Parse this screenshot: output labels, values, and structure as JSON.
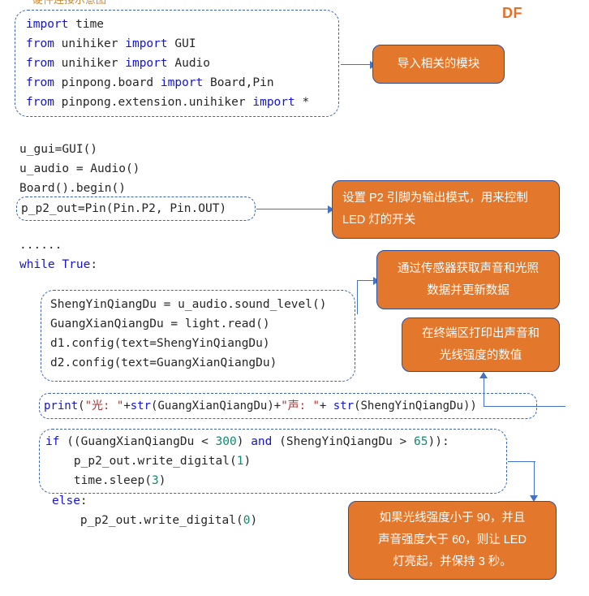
{
  "logo": {
    "text": "DF"
  },
  "top_clipped_heading": {
    "text": "硬件连接示意图"
  },
  "code_blocks": {
    "imports": {
      "lines": [
        "import time",
        "from unihiker import GUI",
        "from unihiker import Audio",
        "from pinpong.board import Board,Pin",
        "from pinpong.extension.unihiker import *"
      ]
    },
    "setup_plain": {
      "lines": [
        "u_gui=GUI()",
        "u_audio = Audio()",
        "Board().begin()"
      ]
    },
    "pin_setup": {
      "lines": [
        "p_p2_out=Pin(Pin.P2, Pin.OUT)"
      ]
    },
    "loop_plain": {
      "lines": [
        "......",
        "while True:"
      ]
    },
    "sensor_read": {
      "lines": [
        "ShengYinQiangDu = u_audio.sound_level()",
        "GuangXianQiangDu = light.read()",
        "d1.config(text=ShengYinQiangDu)",
        "d2.config(text=GuangXianQiangDu)"
      ]
    },
    "print_line": {
      "lines": [
        "print(\"光: \"+str(GuangXianQiangDu)+\"声: \"+ str(ShengYinQiangDu))"
      ]
    },
    "if_block": {
      "lines": [
        "if ((GuangXianQiangDu < 300) and (ShengYinQiangDu > 65)):",
        "    p_p2_out.write_digital(1)",
        "    time.sleep(3)"
      ]
    },
    "else_block": {
      "lines": [
        "else:",
        "    p_p2_out.write_digital(0)"
      ]
    }
  },
  "callouts": {
    "imports": {
      "lines": [
        "导入相关的模块"
      ],
      "align": "center"
    },
    "pin_setup": {
      "lines": [
        "设置 P2 引脚为输出模式，用来控制",
        "LED 灯的开关"
      ],
      "align": "left"
    },
    "sensor_read": {
      "lines": [
        "通过传感器获取声音和光照",
        "数据并更新数据"
      ],
      "align": "center"
    },
    "print_line": {
      "lines": [
        "在终端区打印出声音和",
        "光线强度的数值"
      ],
      "align": "center"
    },
    "if_block": {
      "lines": [
        "如果光线强度小于 90，并且",
        "声音强度大于 60，则让 LED",
        "灯亮起，并保持 3 秒。"
      ],
      "align": "center"
    }
  },
  "colors": {
    "orange": "#E3772B",
    "callout_border": "#2f4f9b",
    "dashed_border": "#3b63b5",
    "connector": "#4472c4",
    "keyword": "#1414d2",
    "number": "#128a6e",
    "string": "#b03030",
    "code_text": "#262626",
    "logo": "#E3702B"
  }
}
